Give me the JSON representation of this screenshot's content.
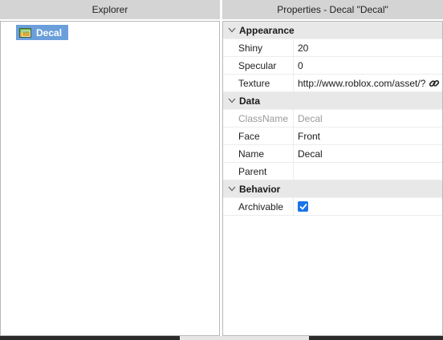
{
  "explorer": {
    "title": "Explorer",
    "items": [
      {
        "label": "Decal",
        "icon": "decal-image-icon"
      }
    ]
  },
  "properties": {
    "title": "Properties - Decal \"Decal\"",
    "categories": [
      {
        "label": "Appearance",
        "props": [
          {
            "name": "Shiny",
            "value": "20"
          },
          {
            "name": "Specular",
            "value": "0"
          },
          {
            "name": "Texture",
            "value": "http://www.roblox.com/asset/?"
          }
        ]
      },
      {
        "label": "Data",
        "props": [
          {
            "name": "ClassName",
            "value": "Decal"
          },
          {
            "name": "Face",
            "value": "Front"
          },
          {
            "name": "Name",
            "value": "Decal"
          },
          {
            "name": "Parent",
            "value": ""
          }
        ]
      },
      {
        "label": "Behavior",
        "props": [
          {
            "name": "Archivable",
            "checked": true
          }
        ]
      }
    ]
  },
  "colors": {
    "header_bg": "#d4d4d4",
    "selection": "#6a9fdb",
    "category_bg": "#e8e8e8",
    "checkbox": "#1a73e8",
    "disabled_text": "#9a9a9a"
  }
}
